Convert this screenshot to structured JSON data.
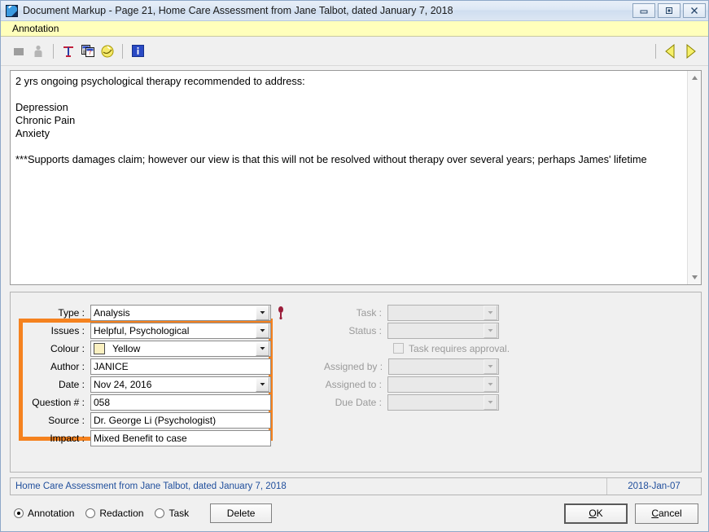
{
  "window": {
    "title": "Document Markup - Page 21, Home Care Assessment from Jane Talbot, dated January 7, 2018",
    "app_icon": "markup-pen-icon",
    "controls": {
      "minimize": "minimize-icon",
      "restore": "restore-icon",
      "close": "close-icon"
    }
  },
  "menubar": {
    "items": [
      {
        "label": "Annotation"
      }
    ]
  },
  "toolbar": {
    "buttons": [
      {
        "name": "stop-recording-icon",
        "enabled": false
      },
      {
        "name": "person-icon",
        "enabled": false
      },
      {
        "name": "text-annotation-icon",
        "enabled": true
      },
      {
        "name": "sticky-note-icon",
        "enabled": true
      },
      {
        "name": "highlight-circle-icon",
        "enabled": true
      },
      {
        "name": "info-icon",
        "enabled": true
      }
    ],
    "nav": [
      {
        "name": "previous-annotation-icon"
      },
      {
        "name": "next-annotation-icon"
      }
    ]
  },
  "editor": {
    "text": "2 yrs ongoing psychological therapy recommended to address:\n\nDepression\nChronic Pain\nAnxiety\n\n***Supports damages claim; however our view is that this will not be resolved without therapy over several years; perhaps James' lifetime",
    "scrollbar": {
      "up": "scroll-up-icon",
      "down": "scroll-down-icon"
    }
  },
  "form": {
    "highlight_color": "#F5821F",
    "pin_icon": "pin-marker-icon",
    "left_fields": [
      {
        "label": "Type :",
        "value": "Analysis",
        "control": "combo",
        "enabled": true
      },
      {
        "label": "Issues :",
        "value": "Helpful, Psychological",
        "control": "combo",
        "enabled": true
      },
      {
        "label": "Colour :",
        "value": "Yellow",
        "control": "combo-color",
        "swatch": "#FAF0C0",
        "enabled": true
      },
      {
        "label": "Author :",
        "value": "JANICE",
        "control": "text",
        "enabled": true
      },
      {
        "label": "Date :",
        "value": "Nov 24, 2016",
        "control": "combo",
        "enabled": true
      },
      {
        "label": "Question # :",
        "value": "058",
        "control": "text",
        "enabled": true
      },
      {
        "label": "Source :",
        "value": "Dr. George Li (Psychologist)",
        "control": "text",
        "enabled": true
      },
      {
        "label": "Impact :",
        "value": "Mixed Benefit to case",
        "control": "text",
        "enabled": true
      }
    ],
    "right_fields": [
      {
        "label": "Task :",
        "value": "",
        "control": "combo",
        "enabled": false
      },
      {
        "label": "Status :",
        "value": "",
        "control": "combo",
        "enabled": false
      }
    ],
    "checkbox": {
      "label": "Task requires approval.",
      "checked": false,
      "enabled": false
    },
    "right_fields2": [
      {
        "label": "Assigned by :",
        "value": "",
        "control": "combo",
        "enabled": false
      },
      {
        "label": "Assigned to :",
        "value": "",
        "control": "combo",
        "enabled": false
      },
      {
        "label": "Due Date :",
        "value": "",
        "control": "combo",
        "enabled": false
      }
    ]
  },
  "statusbar": {
    "document": "Home Care Assessment from Jane Talbot, dated January 7, 2018",
    "date": "2018-Jan-07",
    "text_color": "#1F4E9C"
  },
  "bottom": {
    "radios": [
      {
        "label": "Annotation",
        "checked": true
      },
      {
        "label": "Redaction",
        "checked": false
      },
      {
        "label": "Task",
        "checked": false
      }
    ],
    "delete_label": "Delete",
    "ok_label": "OK",
    "ok_accel": "O",
    "ok_rest": "K",
    "cancel_label": "Cancel",
    "cancel_accel": "C",
    "cancel_rest": "ancel"
  }
}
